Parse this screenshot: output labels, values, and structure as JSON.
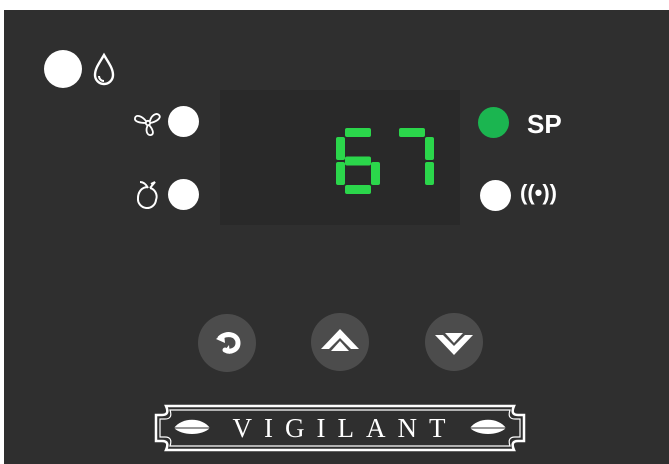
{
  "display": {
    "value": "67",
    "digit_color": "#2bd64b"
  },
  "indicators": {
    "setpoint_label": "SP",
    "alarm_label": "((•))",
    "setpoint_led_color": "#1bb550"
  },
  "icons": {
    "defrost_drop": "water-drop-icon",
    "fan": "fan-icon",
    "compressor": "compressor-icon"
  },
  "buttons": {
    "cycle": "refresh-icon",
    "up": "chevron-up-icon",
    "down": "chevron-down-icon"
  },
  "brand": {
    "name": "VIGILANT"
  },
  "colors": {
    "panel": "#2f2f2f",
    "button": "#4c4c4c",
    "led_white": "#ffffff"
  }
}
